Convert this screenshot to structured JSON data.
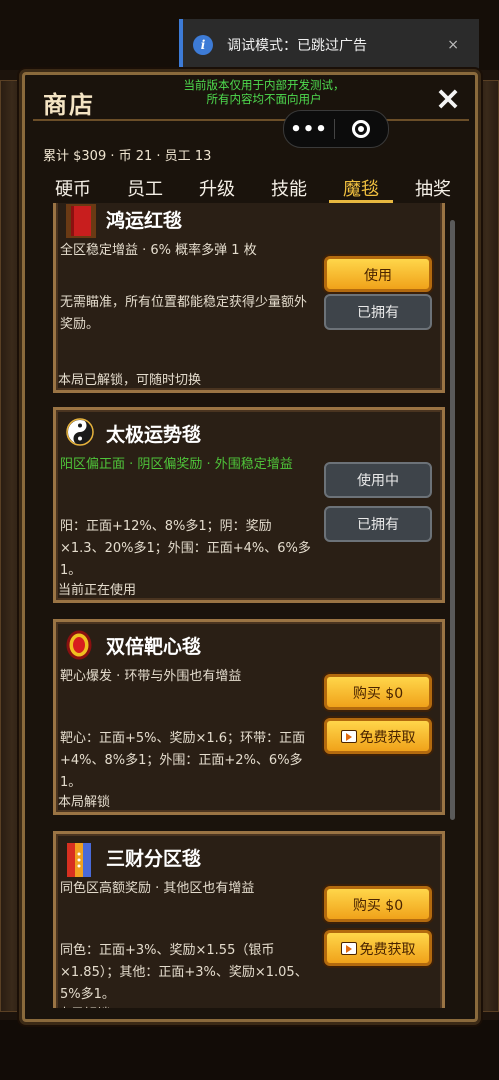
{
  "toast": {
    "message": "调试模式：已跳过广告",
    "close": "×",
    "icon": "info-icon"
  },
  "shop": {
    "title": "商店",
    "close": "×",
    "dev_note_line1": "当前版本仅用于内部开发测试，",
    "dev_note_line2": "所有内容均不面向用户",
    "stats": "累计 $309 · 币 21 · 员工 13",
    "tabs": [
      {
        "label": "硬币",
        "active": false
      },
      {
        "label": "员工",
        "active": false
      },
      {
        "label": "升级",
        "active": false
      },
      {
        "label": "技能",
        "active": false
      },
      {
        "label": "魔毯",
        "active": true
      },
      {
        "label": "抽奖",
        "active": false
      }
    ],
    "items": [
      {
        "name": "鸿运红毯",
        "icon": "red-carpet-icon",
        "summary": "全区稳定增益 · 6% 概率多弹 1 枚",
        "summary_green": false,
        "desc": "无需瞄准，所有位置都能稳定获得少量额外奖励。",
        "foot": "本局已解锁，可随时切换",
        "btn1": "使用",
        "btn1_style": "gold",
        "btn2": "已拥有",
        "btn2_style": "gray"
      },
      {
        "name": "太极运势毯",
        "icon": "yin-yang-icon",
        "summary": "阳区偏正面 · 阴区偏奖励 · 外围稳定增益",
        "summary_green": true,
        "desc": "阳：正面+12%、8%多1；阴：奖励×1.3、20%多1；外围：正面+4%、6%多1。",
        "foot": "当前正在使用",
        "btn1": "使用中",
        "btn1_style": "gray",
        "btn2": "已拥有",
        "btn2_style": "gray"
      },
      {
        "name": "双倍靶心毯",
        "icon": "bullseye-icon",
        "summary": "靶心爆发 · 环带与外围也有增益",
        "summary_green": false,
        "desc": "靶心：正面+5%、奖励×1.6；环带：正面+4%、8%多1；外围：正面+2%、6%多1。",
        "foot": "本局解锁",
        "btn1": "购买 $0",
        "btn1_style": "gold",
        "btn2": "免费获取",
        "btn2_style": "gold"
      },
      {
        "name": "三财分区毯",
        "icon": "tri-color-icon",
        "summary": "同色区高额奖励 · 其他区也有增益",
        "summary_green": false,
        "desc": "同色：正面+3%、奖励×1.55（银币×1.85）；其他：正面+3%、奖励×1.05、5%多1。",
        "foot": "本局解锁",
        "btn1": "购买 $0",
        "btn1_style": "gold",
        "btn2": "免费获取",
        "btn2_style": "gold"
      }
    ]
  },
  "colors": {
    "accent_gold": "#f0c040",
    "frame": "#8a6a3c",
    "green_text": "#4fc43a",
    "dev_note": "#4fdc4f"
  }
}
